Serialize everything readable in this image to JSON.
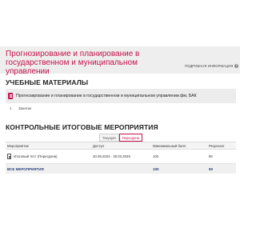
{
  "header": {
    "title": "Прогнозирование и планирование в государственном и муниципальном управлении",
    "details_link": "ПОДРОБНАЯ ИНФОРМАЦИЯ",
    "details_icon": "info-icon"
  },
  "materials": {
    "section_title": "УЧЕБНЫЕ МАТЕРИАЛЫ",
    "items": [
      {
        "label": "Прогнозирование и планирование в государственном и муниципальном управлении.фм, БАК",
        "icon": "document-icon"
      }
    ],
    "lessons": [
      {
        "number": "1",
        "label": "Занятие"
      }
    ]
  },
  "events": {
    "section_title": "КОНТРОЛЬНЫЕ ИТОГОВЫЕ МЕРОПРИЯТИЯ",
    "tabs": [
      {
        "label": "Текущая",
        "active": false
      },
      {
        "label": "Пересдача",
        "active": true
      }
    ],
    "columns": [
      "Мероприятие",
      "Доступ",
      "Максимальный балл",
      "Результат"
    ],
    "rows": [
      {
        "event": "Итоговый тест (Пересдача)",
        "access": "20.09.2024 - 30.03.2025",
        "max_score": "100",
        "result": "90"
      }
    ],
    "total": {
      "label": "ВСЕ МЕРОПРИЯТИЯ",
      "max_score": "100",
      "result": "90"
    }
  },
  "colors": {
    "accent": "#c3124a",
    "total_text": "#2a3f7a",
    "hero_bg": "#eeeeee"
  }
}
